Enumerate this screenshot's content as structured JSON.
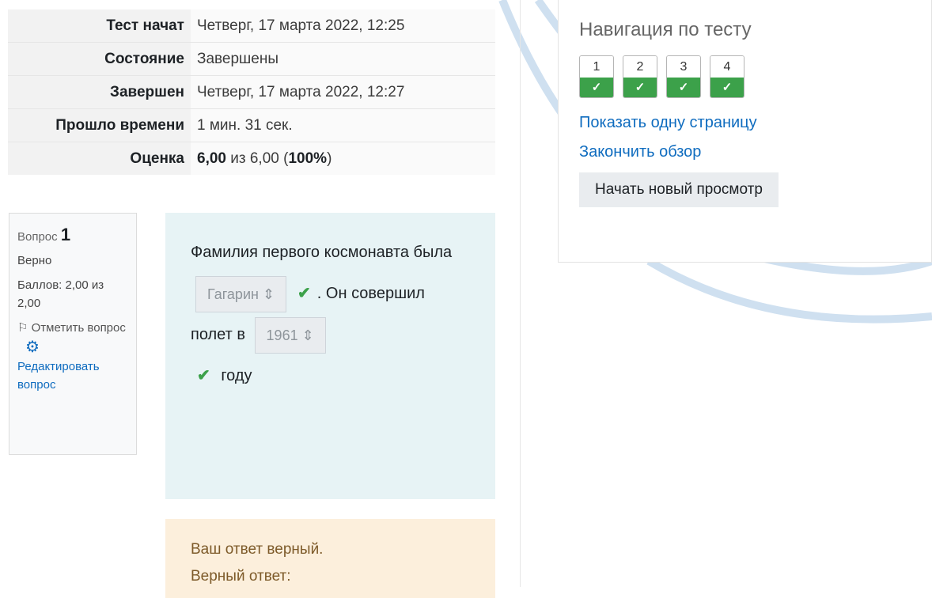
{
  "summary": {
    "rows": [
      {
        "label": "Тест начат",
        "value": "Четверг, 17 марта 2022, 12:25"
      },
      {
        "label": "Состояние",
        "value": "Завершены"
      },
      {
        "label": "Завершен",
        "value": "Четверг, 17 марта 2022, 12:27"
      },
      {
        "label": "Прошло времени",
        "value": "1 мин. 31 сек."
      }
    ],
    "grade": {
      "label": "Оценка",
      "score": "6,00",
      "mid": " из 6,00 (",
      "percent": "100%",
      "tail": ")"
    }
  },
  "question": {
    "prefix": "Вопрос",
    "number": "1",
    "state": "Верно",
    "marks": "Баллов: 2,00 из 2,00",
    "flag_label": "Отметить вопрос",
    "edit_label": "Редактировать вопрос",
    "text_part1": "Фамилия первого космонавта была",
    "select1_value": "Гагарин",
    "text_part2": ". Он совершил полет в",
    "select2_value": "1961",
    "text_part3": "году"
  },
  "feedback": {
    "line1": "Ваш ответ верный.",
    "line2": "Верный ответ:"
  },
  "nav": {
    "title": "Навигация по тесту",
    "buttons": [
      "1",
      "2",
      "3",
      "4"
    ],
    "show_one_page": "Показать одну страницу",
    "finish_review": "Закончить обзор",
    "start_new": "Начать новый просмотр"
  },
  "colors": {
    "correct": "#3ca14a",
    "link": "#0f6cbf",
    "question_bg": "#e7f3f5",
    "feedback_bg": "#fcefdc"
  }
}
